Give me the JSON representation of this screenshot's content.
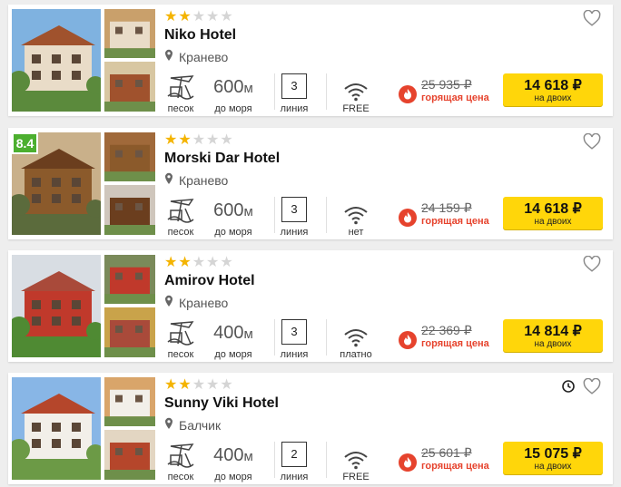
{
  "labels": {
    "beach": "песок",
    "distance_sub": "до моря",
    "line_word": "линия",
    "hot": "горящая цена",
    "per": "на двоих",
    "meter_unit": "м"
  },
  "colors": {
    "accent_button": "#ffd60a",
    "hot_red": "#e6432d",
    "star": "#f4b400",
    "badge_green": "#4caf2f"
  },
  "icons": [
    "heart-icon",
    "location-pin-icon",
    "beach-icon",
    "wifi-icon",
    "fire-icon",
    "clock-icon",
    "star-icon"
  ],
  "hotels": [
    {
      "name": "Niko Hotel",
      "stars": 2,
      "stars_total": 5,
      "location": "Кранево",
      "distance": "600",
      "line": "3",
      "wifi": "FREE",
      "old_price": "25 935 ₽",
      "price": "14 618 ₽",
      "rating": null,
      "has_clock": false
    },
    {
      "name": "Morski Dar Hotel",
      "stars": 2,
      "stars_total": 5,
      "location": "Кранево",
      "distance": "600",
      "line": "3",
      "wifi": "нет",
      "old_price": "24 159 ₽",
      "price": "14 618 ₽",
      "rating": "8.4",
      "has_clock": false
    },
    {
      "name": "Amirov Hotel",
      "stars": 2,
      "stars_total": 5,
      "location": "Кранево",
      "distance": "400",
      "line": "3",
      "wifi": "платно",
      "old_price": "22 369 ₽",
      "price": "14 814 ₽",
      "rating": null,
      "has_clock": false
    },
    {
      "name": "Sunny Viki Hotel",
      "stars": 2,
      "stars_total": 5,
      "location": "Балчик",
      "distance": "400",
      "line": "2",
      "wifi": "FREE",
      "old_price": "25 601 ₽",
      "price": "15 075 ₽",
      "rating": null,
      "has_clock": true
    }
  ]
}
